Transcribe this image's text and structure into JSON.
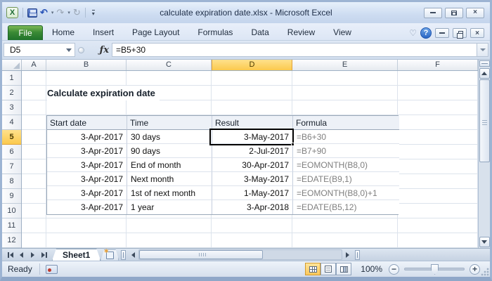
{
  "window": {
    "title": "calculate expiration date.xlsx - Microsoft Excel",
    "excel_logo_letter": "X",
    "help_label": "?"
  },
  "ribbon": {
    "file_tab": "File",
    "tabs": [
      "Home",
      "Insert",
      "Page Layout",
      "Formulas",
      "Data",
      "Review",
      "View"
    ]
  },
  "formula_bar": {
    "cell_ref": "D5",
    "fx_label": "ƒx",
    "formula": "=B5+30"
  },
  "sheet": {
    "columns": [
      "A",
      "B",
      "C",
      "D",
      "E",
      "F"
    ],
    "rows": [
      "1",
      "2",
      "3",
      "4",
      "5",
      "6",
      "7",
      "8",
      "9",
      "10",
      "11",
      "12"
    ],
    "selection": {
      "col": "D",
      "row": "5",
      "ref": "D5"
    },
    "title_cell": "Calculate expiration date",
    "table": {
      "headers": [
        "Start date",
        "Time",
        "Result",
        "Formula"
      ],
      "rows": [
        {
          "start": "3-Apr-2017",
          "time": "30 days",
          "result": "3-May-2017",
          "formula": "=B6+30"
        },
        {
          "start": "3-Apr-2017",
          "time": "90 days",
          "result": "2-Jul-2017",
          "formula": "=B7+90"
        },
        {
          "start": "3-Apr-2017",
          "time": "End of month",
          "result": "30-Apr-2017",
          "formula": "=EOMONTH(B8,0)"
        },
        {
          "start": "3-Apr-2017",
          "time": "Next month",
          "result": "3-May-2017",
          "formula": "=EDATE(B9,1)"
        },
        {
          "start": "3-Apr-2017",
          "time": "1st of next month",
          "result": "1-May-2017",
          "formula": "=EOMONTH(B8,0)+1"
        },
        {
          "start": "3-Apr-2017",
          "time": "1 year",
          "result": "3-Apr-2018",
          "formula": "=EDATE(B5,12)"
        }
      ]
    }
  },
  "tabbar": {
    "sheets": [
      "Sheet1"
    ]
  },
  "status_bar": {
    "mode": "Ready",
    "zoom_level": "100%"
  },
  "colors": {
    "file_tab_green": "#2e7d2b",
    "selection_header_amber": "#fbc94d",
    "formula_text_gray": "#7f7f7f",
    "selected_cell_border": "#000000"
  }
}
